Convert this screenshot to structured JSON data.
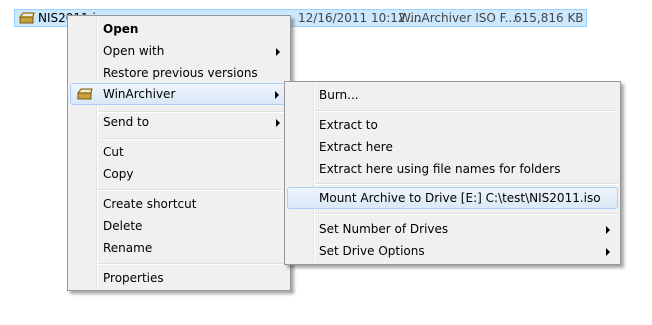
{
  "file_row": {
    "name": "NIS2011.iso",
    "date": "12/16/2011 10:12 ...",
    "type": "WinArchiver ISO F...",
    "size": "615,816 KB",
    "icon": "winarchiver-file-icon"
  },
  "context_menu": {
    "items": [
      {
        "label": "Open"
      },
      {
        "label": "Open with"
      },
      {
        "label": "Restore previous versions"
      },
      {
        "label": "WinArchiver",
        "icon": "winarchiver-icon"
      },
      {
        "label": "Send to"
      },
      {
        "label": "Cut"
      },
      {
        "label": "Copy"
      },
      {
        "label": "Create shortcut"
      },
      {
        "label": "Delete"
      },
      {
        "label": "Rename"
      },
      {
        "label": "Properties"
      }
    ]
  },
  "submenu": {
    "items": [
      {
        "label": "Burn..."
      },
      {
        "label": "Extract to"
      },
      {
        "label": "Extract here"
      },
      {
        "label": "Extract here using file names for folders"
      },
      {
        "label": "Mount Archive to Drive [E:] C:\\test\\NIS2011.iso"
      },
      {
        "label": "Set Number of Drives"
      },
      {
        "label": "Set Drive Options"
      }
    ]
  },
  "colors": {
    "selection": "#cce8ff",
    "menu_bg": "#f0f0f0",
    "hover_border": "#aecff7"
  }
}
